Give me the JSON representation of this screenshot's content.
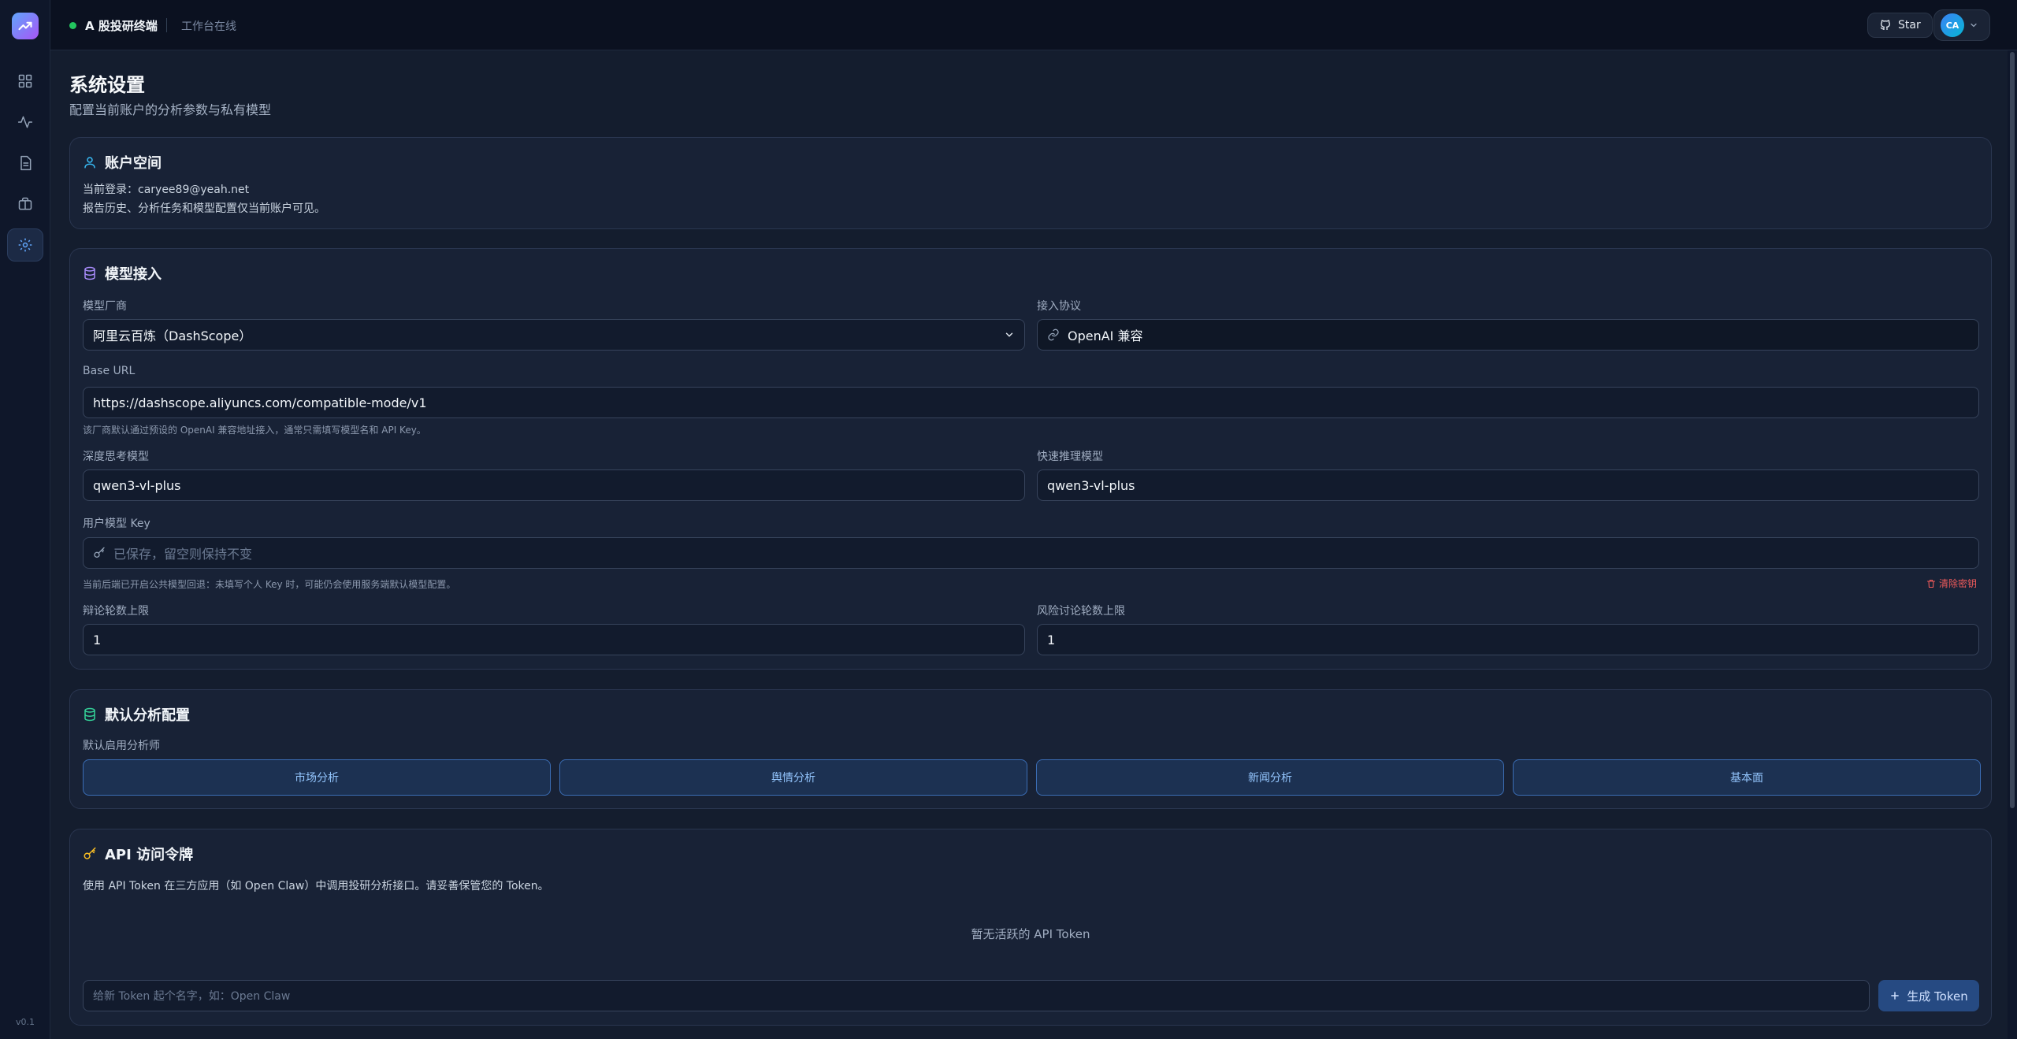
{
  "app": {
    "brand": "A 股投研终端",
    "status": "工作台在线",
    "version": "v0.1",
    "star_label": "Star",
    "avatar_initials": "CA"
  },
  "sidebar": {
    "items": [
      {
        "icon": "dashboard-icon",
        "active": false
      },
      {
        "icon": "activity-icon",
        "active": false
      },
      {
        "icon": "document-icon",
        "active": false
      },
      {
        "icon": "briefcase-icon",
        "active": false
      },
      {
        "icon": "settings-icon",
        "active": true
      }
    ]
  },
  "page": {
    "title": "系统设置",
    "subtitle": "配置当前账户的分析参数与私有模型"
  },
  "account": {
    "title": "账户空间",
    "login_line": "当前登录：caryee89@yeah.net",
    "note": "报告历史、分析任务和模型配置仅当前账户可见。"
  },
  "model": {
    "title": "模型接入",
    "vendor_label": "模型厂商",
    "vendor_value": "阿里云百炼（DashScope）",
    "protocol_label": "接入协议",
    "protocol_value": "OpenAI 兼容",
    "base_url_label": "Base URL",
    "base_url_value": "https://dashscope.aliyuncs.com/compatible-mode/v1",
    "base_url_hint": "该厂商默认通过预设的 OpenAI 兼容地址接入，通常只需填写模型名和 API Key。",
    "deep_label": "深度思考模型",
    "deep_value": "qwen3-vl-plus",
    "quick_label": "快速推理模型",
    "quick_value": "qwen3-vl-plus",
    "key_label": "用户模型 Key",
    "key_placeholder": "已保存，留空则保持不变",
    "key_hint": "当前后端已开启公共模型回退：未填写个人 Key 时，可能仍会使用服务端默认模型配置。",
    "clear_key": "清除密钥",
    "debate_label": "辩论轮数上限",
    "debate_value": "1",
    "risk_label": "风险讨论轮数上限",
    "risk_value": "1"
  },
  "defaults": {
    "title": "默认分析配置",
    "analysts_label": "默认启用分析师",
    "analysts": [
      "市场分析",
      "舆情分析",
      "新闻分析",
      "基本面"
    ]
  },
  "api": {
    "title": "API 访问令牌",
    "description": "使用 API Token 在三方应用（如 Open Claw）中调用投研分析接口。请妥善保管您的 Token。",
    "empty": "暂无活跃的 API Token",
    "name_placeholder": "给新 Token 起个名字，如：Open Claw",
    "generate": "生成 Token"
  },
  "colors": {
    "background": "#141d2e",
    "card": "#182236",
    "accent": "#3b82f6",
    "danger": "#f05b5b",
    "online": "#22c55e"
  }
}
